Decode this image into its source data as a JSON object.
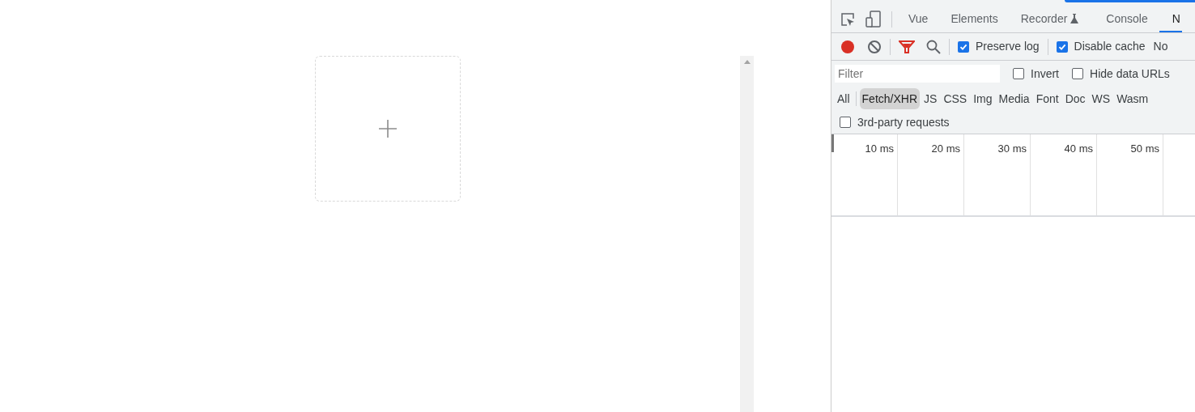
{
  "devtools": {
    "tabs": [
      {
        "label": "Vue",
        "selected": false
      },
      {
        "label": "Elements",
        "selected": false
      },
      {
        "label": "Recorder",
        "selected": false,
        "experimental": true
      },
      {
        "label": "Console",
        "selected": false
      },
      {
        "label": "N",
        "selected": true
      }
    ],
    "toolbar": {
      "recording": true,
      "checkboxes": [
        {
          "label": "Preserve log",
          "checked": true
        },
        {
          "label": "Disable cache",
          "checked": true
        }
      ],
      "throttling": "No"
    },
    "filter": {
      "placeholder": "Filter",
      "options": [
        {
          "label": "Invert",
          "checked": false
        },
        {
          "label": "Hide data URLs",
          "checked": false
        }
      ]
    },
    "types": [
      {
        "label": "All",
        "selected": false
      },
      {
        "label": "Fetch/XHR",
        "selected": true
      },
      {
        "label": "JS",
        "selected": false
      },
      {
        "label": "CSS",
        "selected": false
      },
      {
        "label": "Img",
        "selected": false
      },
      {
        "label": "Media",
        "selected": false
      },
      {
        "label": "Font",
        "selected": false
      },
      {
        "label": "Doc",
        "selected": false
      },
      {
        "label": "WS",
        "selected": false
      },
      {
        "label": "Wasm",
        "selected": false
      }
    ],
    "third_party": {
      "label": "3rd-party requests",
      "checked": false
    },
    "timeline_ticks": [
      "10 ms",
      "20 ms",
      "30 ms",
      "40 ms",
      "50 ms"
    ]
  }
}
